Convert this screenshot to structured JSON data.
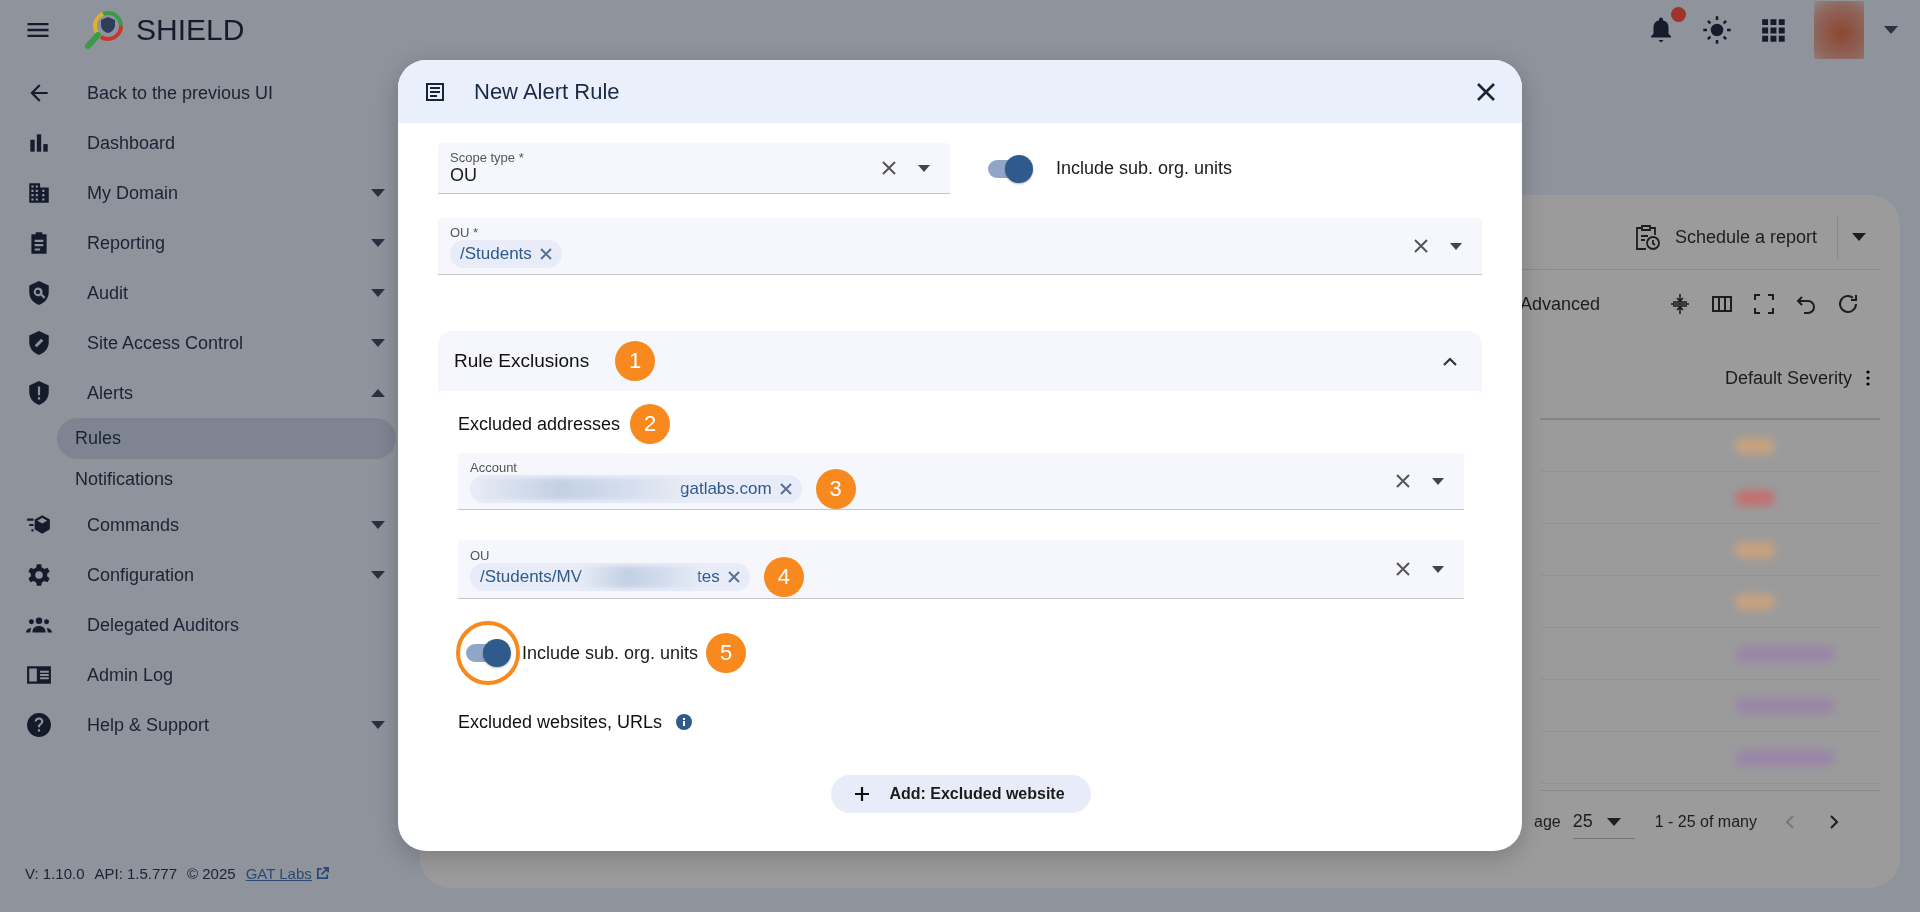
{
  "app_bar": {
    "title": "SHIELD",
    "notifications": {
      "unread": true
    }
  },
  "sidebar": {
    "items": [
      {
        "label": "Back to the previous UI"
      },
      {
        "label": "Dashboard"
      },
      {
        "label": "My Domain",
        "expanded": false
      },
      {
        "label": "Reporting",
        "expanded": false
      },
      {
        "label": "Audit",
        "expanded": false
      },
      {
        "label": "Site Access Control",
        "expanded": false
      },
      {
        "label": "Alerts",
        "expanded": true,
        "children": [
          {
            "label": "Rules",
            "selected": true
          },
          {
            "label": "Notifications",
            "selected": false
          }
        ]
      },
      {
        "label": "Commands",
        "expanded": false
      },
      {
        "label": "Configuration",
        "expanded": false
      },
      {
        "label": "Delegated Auditors"
      },
      {
        "label": "Admin Log"
      },
      {
        "label": "Help & Support",
        "expanded": false
      }
    ],
    "footer": {
      "version": "V: 1.10.0",
      "api": "API: 1.5.777",
      "copyright": "© 2025",
      "link": "GAT Labs"
    }
  },
  "background_panel": {
    "schedule_button": "Schedule a report",
    "filter_label": "Advanced",
    "column_header": "Default Severity",
    "pagination": {
      "per_page_label": "age",
      "per_page": "25",
      "range": "1 - 25 of many"
    }
  },
  "dialog": {
    "title": "New Alert Rule",
    "scope_type": {
      "label": "Scope type *",
      "value": "OU"
    },
    "include_sub_units": {
      "label": "Include sub. org. units",
      "on": true
    },
    "ou": {
      "label": "OU *",
      "chips": [
        {
          "text": "/Students"
        }
      ]
    },
    "exclusions": {
      "title": "Rule Exclusions",
      "badge": "1",
      "expanded": true,
      "addresses_label": "Excluded addresses",
      "addresses_badge": "2",
      "account": {
        "label": "Account",
        "badge": "3",
        "chips": [
          {
            "redacted": true,
            "text_after": "gatlabs.com"
          }
        ]
      },
      "ou": {
        "label": "OU",
        "badge": "4",
        "chips": [
          {
            "text_before": "/Students/MV",
            "redacted": true,
            "text_after": "tes"
          }
        ]
      },
      "include_sub_units": {
        "label": "Include sub. org. units",
        "on": true,
        "highlighted": true,
        "badge": "5"
      },
      "websites_label": "Excluded websites, URLs",
      "add_button": "Add: Excluded website"
    }
  }
}
